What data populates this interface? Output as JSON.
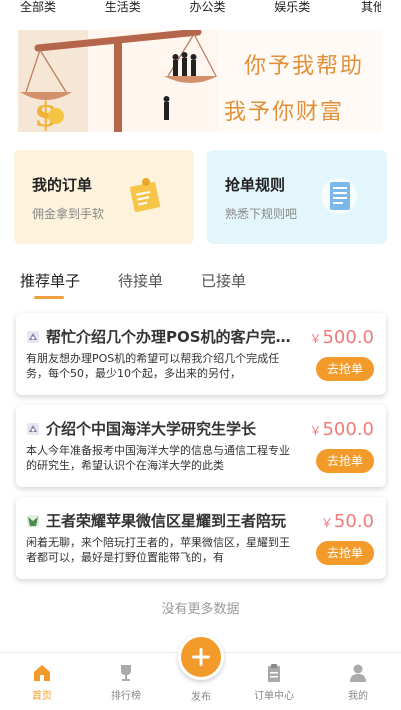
{
  "categories": [
    "全部类",
    "生活类",
    "办公类",
    "娱乐类",
    "其他类"
  ],
  "banner": {
    "line1": "你予我帮助",
    "line2": "我予你财富"
  },
  "quick_cards": [
    {
      "title": "我的订单",
      "subtitle": "佣金拿到手软",
      "icon": "order-doc-icon",
      "color": "#fdf3dc"
    },
    {
      "title": "抢单规则",
      "subtitle": "熟悉下规则吧",
      "icon": "rules-doc-icon",
      "color": "#e3f6fb"
    }
  ],
  "tabs": [
    "推荐单子",
    "待接单",
    "已接单"
  ],
  "tasks": [
    {
      "icon": "task-type-icon",
      "title": "帮忙介绍几个办理POS机的客户完成任务",
      "desc": "有朋友想办理POS机的希望可以帮我介绍几个完成任务，每个50，最少10个起，多出来的另付，",
      "currency": "￥",
      "price": "500.0",
      "button": "去抢单"
    },
    {
      "icon": "task-type-icon",
      "title": "介绍个中国海洋大学研究生学长",
      "desc": "本人今年准备报考中国海洋大学的信息与通信工程专业的研究生，希望认识个在海洋大学的此类",
      "currency": "￥",
      "price": "500.0",
      "button": "去抢单"
    },
    {
      "icon": "game-icon",
      "title": "王者荣耀苹果微信区星耀到王者陪玩",
      "desc": "闲着无聊，来个陪玩打王者的，苹果微信区，星耀到王者都可以，最好是打野位置能带飞的，有",
      "currency": "￥",
      "price": "50.0",
      "button": "去抢单"
    }
  ],
  "no_more": "没有更多数据",
  "nav": {
    "home": "首页",
    "rank": "排行榜",
    "publish": "发布",
    "orders": "订单中心",
    "me": "我的"
  },
  "colors": {
    "accent": "#f29a2a",
    "price": "#ef7b7b"
  }
}
